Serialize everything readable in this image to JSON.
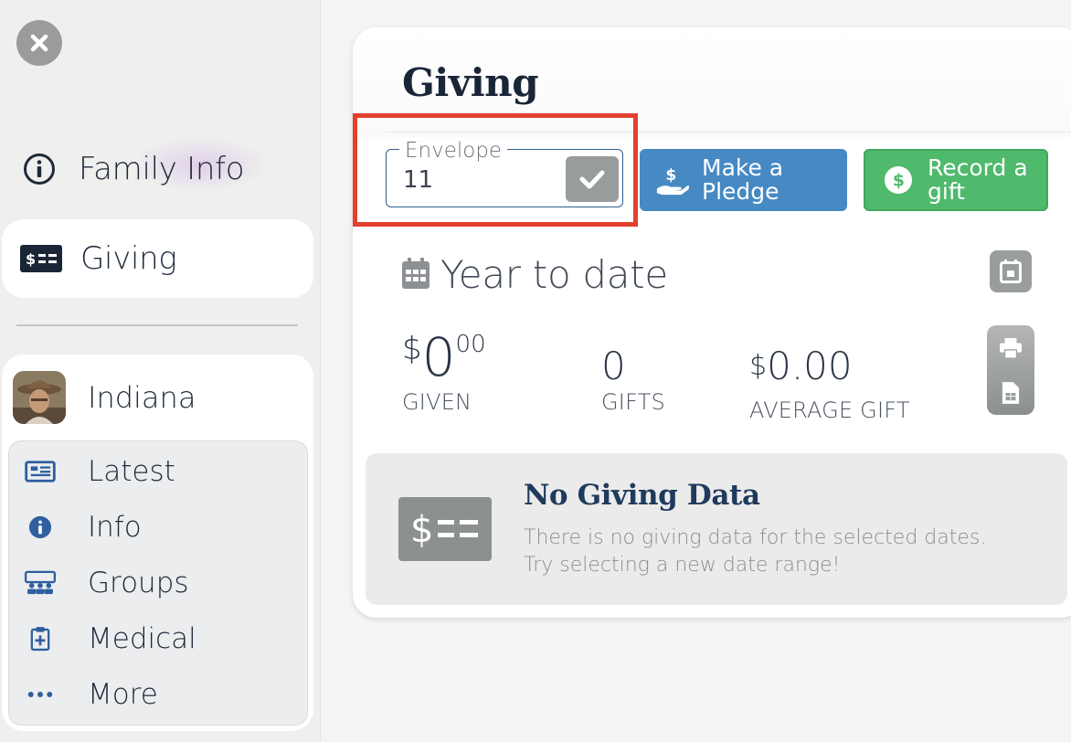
{
  "sidebar": {
    "close_icon": "close-icon",
    "family_info_label": "Family Info",
    "giving_label": "Giving",
    "person": {
      "name": "Indiana",
      "menu": [
        {
          "label": "Latest",
          "icon": "newspaper-icon"
        },
        {
          "label": "Info",
          "icon": "info-icon"
        },
        {
          "label": "Groups",
          "icon": "groups-icon"
        },
        {
          "label": "Medical",
          "icon": "medical-icon"
        },
        {
          "label": "More",
          "icon": "ellipsis-icon"
        }
      ]
    }
  },
  "main": {
    "title": "Giving",
    "envelope": {
      "label": "Envelope",
      "value": "11"
    },
    "buttons": {
      "pledge_line1": "Make a",
      "pledge_line2": "Pledge",
      "gift_line1": "Record a",
      "gift_line2": "gift"
    },
    "year_to_date": {
      "title": "Year to date",
      "given_currency": "$",
      "given_whole": "0",
      "given_cents": "00",
      "given_label": "GIVEN",
      "gifts_value": "0",
      "gifts_label": "GIFTS",
      "avg_currency": "$",
      "avg_value": "0.00",
      "avg_label": "AVERAGE GIFT"
    },
    "no_data": {
      "title": "No Giving Data",
      "line1": "There is no giving data for the selected dates.",
      "line2": "Try selecting a new date range!"
    }
  },
  "colors": {
    "pledge": "#4689c3",
    "gift": "#4fb96c",
    "highlight": "#e3402e",
    "navy": "#1a2638",
    "gray_button": "#999c9c"
  }
}
